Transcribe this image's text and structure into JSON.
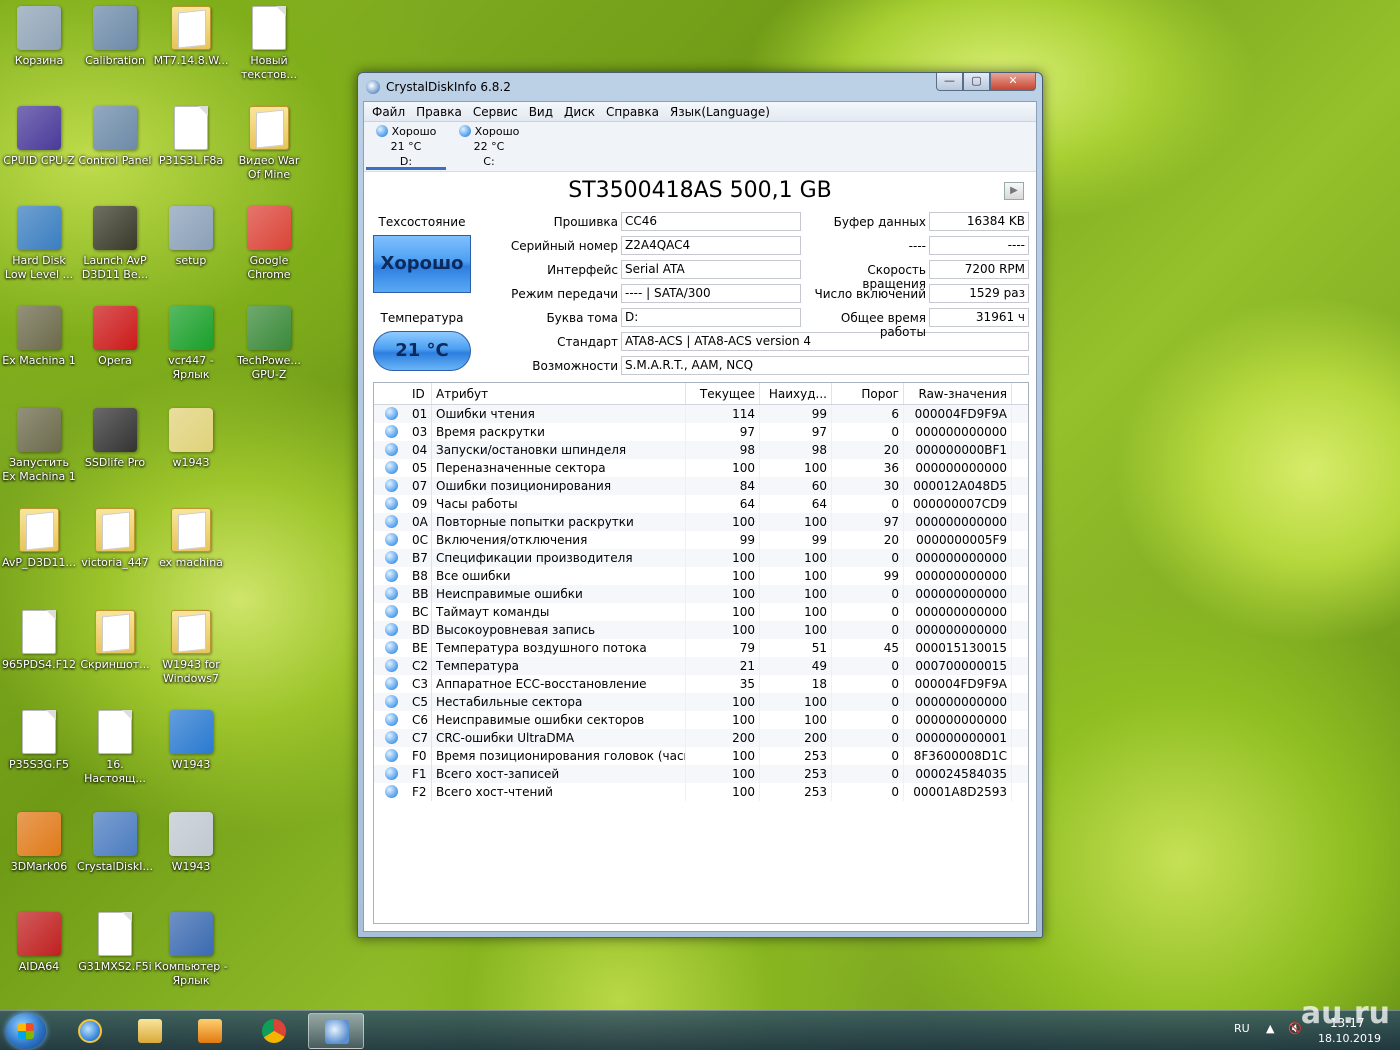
{
  "desktop": {
    "icons": [
      {
        "label": "Корзина",
        "type": "app",
        "color": "#8fa3b6"
      },
      {
        "label": "Calibration",
        "type": "app",
        "color": "#6c8aa8"
      },
      {
        "label": "MT7.14.8.W...",
        "type": "folder"
      },
      {
        "label": "Новый текстов...",
        "type": "file"
      },
      {
        "label": "CPUID CPU-Z",
        "type": "app",
        "color": "#4a3a9a"
      },
      {
        "label": "Control Panel",
        "type": "app",
        "color": "#6c8aa8"
      },
      {
        "label": "P31S3L.F8a",
        "type": "file"
      },
      {
        "label": "Видео War Of Mine",
        "type": "folder"
      },
      {
        "label": "Hard Disk Low Level ...",
        "type": "app",
        "color": "#3a7ec0"
      },
      {
        "label": "Launch AvP D3D11 Be...",
        "type": "app",
        "color": "#3a3a2a"
      },
      {
        "label": "setup",
        "type": "app",
        "color": "#8aa0b8"
      },
      {
        "label": "Google Chrome",
        "type": "app",
        "color": "#db4437"
      },
      {
        "label": "Ex Machina 1",
        "type": "app",
        "color": "#6b6a4a"
      },
      {
        "label": "Opera",
        "type": "app",
        "color": "#cc1a1a"
      },
      {
        "label": "vcr447 - Ярлык",
        "type": "app",
        "color": "#1aa02a"
      },
      {
        "label": "TechPowe... GPU-Z",
        "type": "app",
        "color": "#3a8a3a"
      },
      {
        "label": "Запустить Ex Machina 1",
        "type": "app",
        "color": "#6b6a4a"
      },
      {
        "label": "SSDlife Pro",
        "type": "app",
        "color": "#333"
      },
      {
        "label": "w1943",
        "type": "app",
        "color": "#e0d27a"
      },
      {
        "label": "AvP_D3D11...",
        "type": "folder"
      },
      {
        "label": "victoria_447",
        "type": "folder"
      },
      {
        "label": "ex machina",
        "type": "folder"
      },
      {
        "label": "965PDS4.F12",
        "type": "file"
      },
      {
        "label": "Скриншот...",
        "type": "folder"
      },
      {
        "label": "W1943 for Windows7",
        "type": "folder"
      },
      {
        "label": "P35S3G.F5",
        "type": "file"
      },
      {
        "label": "16. Настоящ...",
        "type": "file"
      },
      {
        "label": "W1943",
        "type": "app",
        "color": "#2a7ad0"
      },
      {
        "label": "3DMark06",
        "type": "app",
        "color": "#e07a1a"
      },
      {
        "label": "CrystalDiskI...",
        "type": "app",
        "color": "#4b7cc0"
      },
      {
        "label": "W1943",
        "type": "app",
        "color": "#c0c8d0"
      },
      {
        "label": "AIDA64",
        "type": "app",
        "color": "#c02020"
      },
      {
        "label": "G31MXS2.F5i",
        "type": "file"
      },
      {
        "label": "Компьютер - Ярлык",
        "type": "app",
        "color": "#3a6ab0"
      }
    ]
  },
  "window": {
    "title": "CrystalDiskInfo 6.8.2",
    "menu": [
      "Файл",
      "Правка",
      "Сервис",
      "Вид",
      "Диск",
      "Справка",
      "Язык(Language)"
    ],
    "drives": [
      {
        "status": "Хорошо",
        "temp": "21 °C",
        "letter": "D:"
      },
      {
        "status": "Хорошо",
        "temp": "22 °C",
        "letter": "C:"
      }
    ],
    "model": "ST3500418AS 500,1 GB",
    "health_label": "Техсостояние",
    "health_value": "Хорошо",
    "temp_label": "Температура",
    "temp_value": "21 °C",
    "fields": {
      "firmware_label": "Прошивка",
      "firmware": "CC46",
      "serial_label": "Серийный номер",
      "serial": "Z2A4QAC4",
      "interface_label": "Интерфейс",
      "interface": "Serial ATA",
      "transfer_label": "Режим передачи",
      "transfer": "---- | SATA/300",
      "letter_label": "Буква тома",
      "letter": "D:",
      "standard_label": "Стандарт",
      "standard": "ATA8-ACS | ATA8-ACS version 4",
      "features_label": "Возможности",
      "features": "S.M.A.R.T., AAM, NCQ",
      "buffer_label": "Буфер данных",
      "buffer": "16384 KB",
      "nv_label": "----",
      "nv": "----",
      "rpm_label": "Скорость вращения",
      "rpm": "7200 RPM",
      "power_on_count_label": "Число включений",
      "power_on_count": "1529 раз",
      "power_on_hours_label": "Общее время работы",
      "power_on_hours": "31961 ч"
    },
    "table": {
      "headers": [
        "ID",
        "Атрибут",
        "Текущее",
        "Наихуд...",
        "Порог",
        "Raw-значения"
      ],
      "rows": [
        [
          "01",
          "Ошибки чтения",
          "114",
          "99",
          "6",
          "000004FD9F9A"
        ],
        [
          "03",
          "Время раскрутки",
          "97",
          "97",
          "0",
          "000000000000"
        ],
        [
          "04",
          "Запуски/остановки шпинделя",
          "98",
          "98",
          "20",
          "000000000BF1"
        ],
        [
          "05",
          "Переназначенные сектора",
          "100",
          "100",
          "36",
          "000000000000"
        ],
        [
          "07",
          "Ошибки позиционирования",
          "84",
          "60",
          "30",
          "000012A048D5"
        ],
        [
          "09",
          "Часы работы",
          "64",
          "64",
          "0",
          "000000007CD9"
        ],
        [
          "0A",
          "Повторные попытки раскрутки",
          "100",
          "100",
          "97",
          "000000000000"
        ],
        [
          "0C",
          "Включения/отключения",
          "99",
          "99",
          "20",
          "0000000005F9"
        ],
        [
          "B7",
          "Спецификации производителя",
          "100",
          "100",
          "0",
          "000000000000"
        ],
        [
          "B8",
          "Все ошибки",
          "100",
          "100",
          "99",
          "000000000000"
        ],
        [
          "BB",
          "Неисправимые ошибки",
          "100",
          "100",
          "0",
          "000000000000"
        ],
        [
          "BC",
          "Таймаут команды",
          "100",
          "100",
          "0",
          "000000000000"
        ],
        [
          "BD",
          "Высокоуровневая запись",
          "100",
          "100",
          "0",
          "000000000000"
        ],
        [
          "BE",
          "Температура воздушного потока",
          "79",
          "51",
          "45",
          "000015130015"
        ],
        [
          "C2",
          "Температура",
          "21",
          "49",
          "0",
          "000700000015"
        ],
        [
          "C3",
          "Аппаратное ECC-восстановление",
          "35",
          "18",
          "0",
          "000004FD9F9A"
        ],
        [
          "C5",
          "Нестабильные сектора",
          "100",
          "100",
          "0",
          "000000000000"
        ],
        [
          "C6",
          "Неисправимые ошибки секторов",
          "100",
          "100",
          "0",
          "000000000000"
        ],
        [
          "C7",
          "CRC-ошибки UltraDMA",
          "200",
          "200",
          "0",
          "000000000001"
        ],
        [
          "F0",
          "Время позиционирования головок (часы)",
          "100",
          "253",
          "0",
          "8F3600008D1C"
        ],
        [
          "F1",
          "Всего хост-записей",
          "100",
          "253",
          "0",
          "000024584035"
        ],
        [
          "F2",
          "Всего хост-чтений",
          "100",
          "253",
          "0",
          "00001A8D2593"
        ]
      ]
    }
  },
  "taskbar": {
    "lang": "RU",
    "time": "13:17",
    "date": "18.10.2019"
  },
  "watermark": "au.ru"
}
